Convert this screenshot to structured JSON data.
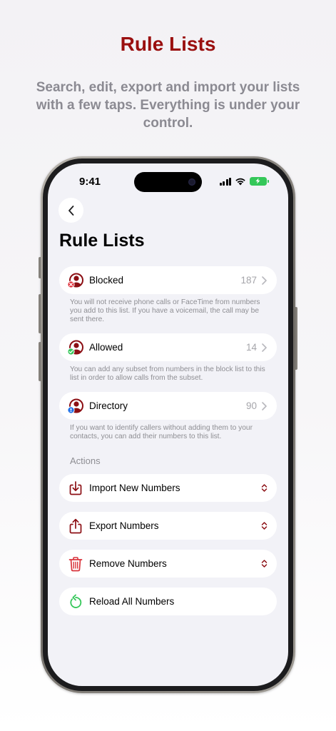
{
  "promo": {
    "title": "Rule Lists",
    "subtitle": "Search, edit, export and import your lists with a few taps. Everything is under your control."
  },
  "status_bar": {
    "time": "9:41",
    "icons": [
      "signal-icon",
      "wifi-icon",
      "battery-charging-icon"
    ]
  },
  "nav": {
    "back_icon": "chevron-left-icon",
    "title": "Rule Lists"
  },
  "lists": [
    {
      "label": "Blocked",
      "count": "187",
      "icon": "person-blocked-icon",
      "footnote": "You will not receive phone calls or FaceTime from numbers you add to this list. If you have a voicemail, the call may be sent there."
    },
    {
      "label": "Allowed",
      "count": "14",
      "icon": "person-allowed-icon",
      "footnote": "You can add any subset from numbers in the block list to this list in order to allow calls from the subset."
    },
    {
      "label": "Directory",
      "count": "90",
      "icon": "person-directory-icon",
      "footnote": "If you want to identify callers without adding them to your contacts, you can add their numbers to this list."
    }
  ],
  "actions": {
    "header": "Actions",
    "items": [
      {
        "label": "Import New Numbers",
        "icon": "import-tray-icon",
        "accessory": "up-down-chevron-icon"
      },
      {
        "label": "Export Numbers",
        "icon": "share-icon",
        "accessory": "up-down-chevron-icon"
      },
      {
        "label": "Remove Numbers",
        "icon": "trash-icon",
        "accessory": "up-down-chevron-icon"
      },
      {
        "label": "Reload All Numbers",
        "icon": "reload-icon",
        "accessory": ""
      }
    ]
  },
  "colors": {
    "brand_red": "#9a0f0f",
    "icon_red": "#8c0f14",
    "reload_green": "#34c759",
    "allowed_badge_green": "#34c759",
    "directory_badge_blue": "#1c6fe8",
    "blocked_badge_red": "#e0303b"
  }
}
